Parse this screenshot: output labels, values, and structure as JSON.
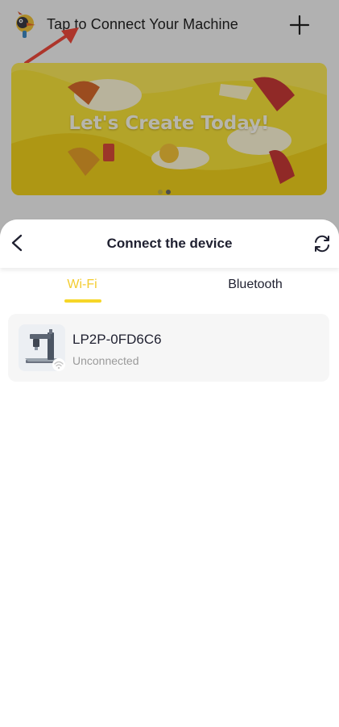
{
  "home": {
    "title": "Tap to Connect Your Machine",
    "banner_text": "Let's Create Today!",
    "icons": {
      "logo": "woodpecker-logo-icon",
      "add": "plus-icon",
      "annotation": "red-arrow-icon"
    },
    "banner_dots": {
      "count": 2,
      "active_index": 1
    }
  },
  "sheet": {
    "title": "Connect the device",
    "back_icon": "chevron-left-icon",
    "refresh_icon": "refresh-icon",
    "tabs": [
      {
        "label": "Wi-Fi",
        "selected": true
      },
      {
        "label": "Bluetooth",
        "selected": false
      }
    ],
    "devices": [
      {
        "name": "LP2P-0FD6C6",
        "status": "Unconnected",
        "icon": "laser-engraver-icon",
        "badge": "wifi-icon"
      }
    ]
  },
  "colors": {
    "accent": "#F3CC2F",
    "tab_underline": "#F6D628",
    "banner": "#F8E33A",
    "text_primary": "#1F2030",
    "text_secondary": "#9A9A9A",
    "annotation_arrow": "#F04A3C"
  }
}
